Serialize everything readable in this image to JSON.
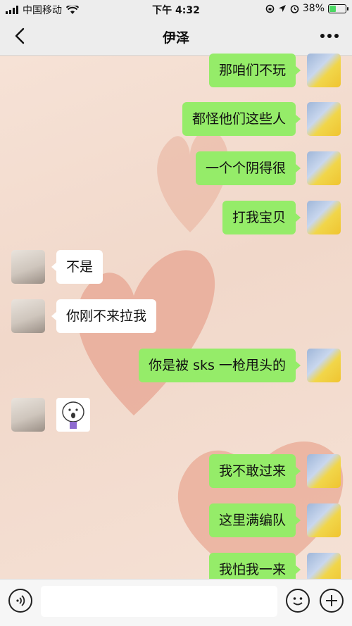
{
  "status_bar": {
    "carrier": "中国移动",
    "time": "下午 4:32",
    "battery": "38%",
    "battery_level": 0.38
  },
  "nav": {
    "title": "伊泽"
  },
  "messages": [
    {
      "side": "me",
      "text": "那咱们不玩"
    },
    {
      "side": "me",
      "text": "都怪他们这些人"
    },
    {
      "side": "me",
      "text": "一个个阴得很"
    },
    {
      "side": "me",
      "text": "打我宝贝"
    },
    {
      "side": "other",
      "text": "不是"
    },
    {
      "side": "other",
      "text": "你刚不来拉我"
    },
    {
      "side": "me",
      "text": "你是被 sks 一枪甩头的"
    },
    {
      "side": "other",
      "text": ""
    },
    {
      "side": "me",
      "text": "我不敢过来"
    },
    {
      "side": "me",
      "text": "这里满编队"
    },
    {
      "side": "me",
      "text": "我怕我一来"
    }
  ],
  "input": {
    "value": ""
  },
  "colors": {
    "my_bubble": "#95ec69",
    "other_bubble": "#ffffff",
    "bar": "#ededed"
  }
}
